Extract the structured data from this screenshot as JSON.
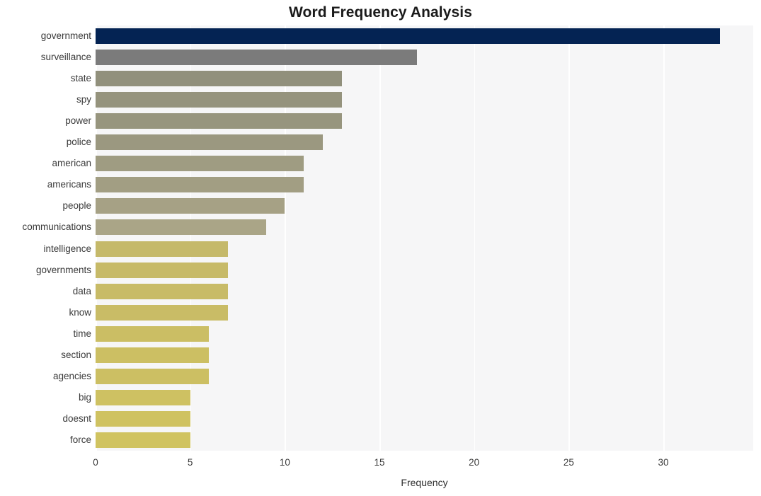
{
  "chart_data": {
    "type": "bar",
    "orientation": "horizontal",
    "title": "Word Frequency Analysis",
    "xlabel": "Frequency",
    "ylabel": "",
    "xlim": [
      0,
      34.75
    ],
    "xticks": [
      0,
      5,
      10,
      15,
      20,
      25,
      30
    ],
    "xtick_labels": [
      "0",
      "5",
      "10",
      "15",
      "20",
      "25",
      "30"
    ],
    "grid": "vertical-white",
    "legend": "none",
    "plot_background": "#f6f6f7",
    "figure_background": "#ffffff",
    "categories": [
      "government",
      "surveillance",
      "state",
      "spy",
      "power",
      "police",
      "american",
      "americans",
      "people",
      "communications",
      "intelligence",
      "governments",
      "data",
      "know",
      "time",
      "section",
      "agencies",
      "big",
      "doesnt",
      "force"
    ],
    "values": [
      33,
      17,
      13,
      13,
      13,
      12,
      11,
      11,
      10,
      9,
      7,
      7,
      7,
      7,
      6,
      6,
      6,
      5,
      5,
      5
    ],
    "bar_colors": [
      "#042353",
      "#7b7b7b",
      "#91907c",
      "#95937d",
      "#97957e",
      "#9b9880",
      "#9f9c82",
      "#a29e83",
      "#a6a185",
      "#aaa587",
      "#c5b96a",
      "#c7ba68",
      "#c8bb67",
      "#c9bc66",
      "#cbbe64",
      "#ccbf63",
      "#ccbf63",
      "#cec162",
      "#cfc261",
      "#d0c360"
    ]
  }
}
